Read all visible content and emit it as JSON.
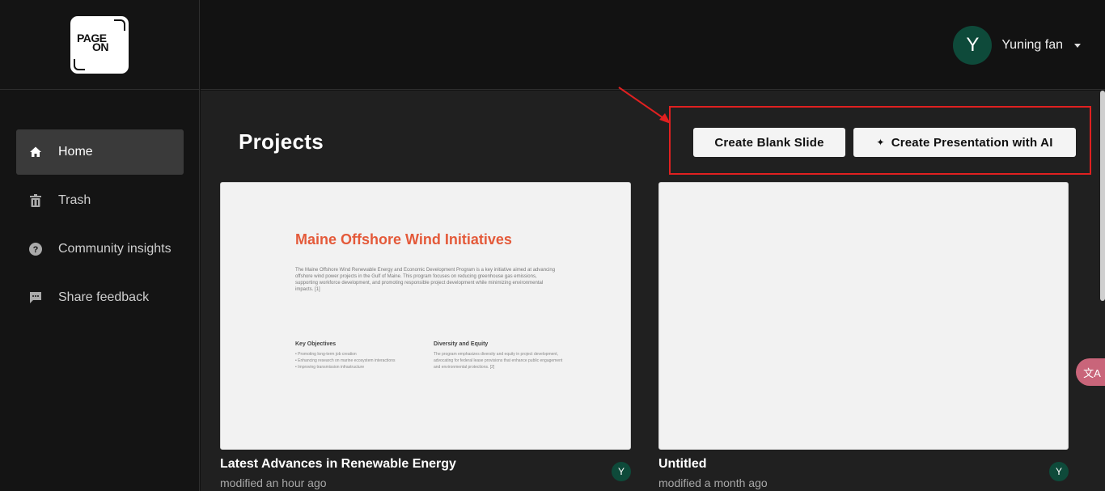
{
  "logo": {
    "line1": "PAGE",
    "line2": "ON"
  },
  "sidebar": {
    "items": [
      {
        "label": "Home",
        "icon": "home-icon"
      },
      {
        "label": "Trash",
        "icon": "trash-icon"
      },
      {
        "label": "Community insights",
        "icon": "help-icon"
      },
      {
        "label": "Share feedback",
        "icon": "feedback-icon"
      }
    ]
  },
  "user": {
    "initial": "Y",
    "name": "Yuning fan"
  },
  "main": {
    "title": "Projects",
    "create_blank_label": "Create Blank Slide",
    "create_ai_label": "Create Presentation with AI"
  },
  "projects": [
    {
      "title": "Latest Advances in Renewable Energy",
      "modified": "modified an hour ago",
      "owner_initial": "Y",
      "slide": {
        "title": "Maine Offshore Wind Initiatives",
        "body": "The Maine Offshore Wind Renewable Energy and Economic Development Program is a key initiative aimed at advancing offshore wind power projects in the Gulf of Maine. This program focuses on reducing greenhouse gas emissions, supporting workforce development, and promoting responsible project development while minimizing environmental impacts. [1]",
        "col1_heading": "Key Objectives",
        "col1_items": [
          "• Promoting long-term job creation",
          "• Enhancing research on marine ecosystem interactions",
          "• Improving transmission infrastructure"
        ],
        "col2_heading": "Diversity and Equity",
        "col2_text": "The program emphasizes diversity and equity in project development, advocating for federal lease provisions that enhance public engagement and environmental protections. [2]"
      }
    },
    {
      "title": "Untitled",
      "modified": "modified a month ago",
      "owner_initial": "Y"
    }
  ],
  "translate_chip": "文A",
  "colors": {
    "accent_red": "#e02020",
    "avatar_green": "#0e4a3a",
    "slide_title": "#e45a3a"
  }
}
